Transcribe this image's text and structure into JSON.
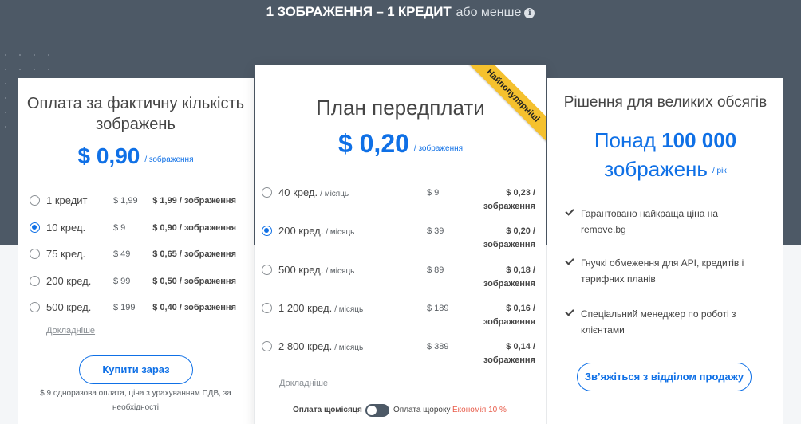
{
  "header": {
    "title": "1 ЗОБРАЖЕННЯ – 1 КРЕДИТ",
    "subtitle": "або менше",
    "info_icon": "i"
  },
  "pay_as_you_go": {
    "title": "Оплата за фактичну кількість зображень",
    "price": "$ 0,90",
    "price_unit": "/ зображення",
    "options": [
      {
        "label": "1 кредит",
        "price": "$ 1,99",
        "per_image": "$ 1,99 / зображення",
        "selected": false
      },
      {
        "label": "10 кред.",
        "price": "$ 9",
        "per_image": "$ 0,90 / зображення",
        "selected": true
      },
      {
        "label": "75 кред.",
        "price": "$ 49",
        "per_image": "$ 0,65 / зображення",
        "selected": false
      },
      {
        "label": "200 кред.",
        "price": "$ 99",
        "per_image": "$ 0,50 / зображення",
        "selected": false
      },
      {
        "label": "500 кред.",
        "price": "$ 199",
        "per_image": "$ 0,40 / зображення",
        "selected": false
      }
    ],
    "details_link": "Докладніше",
    "button": "Купити зараз",
    "footnote_line1": "$ 9 одноразова оплата, ціна з урахуванням ПДВ, за",
    "footnote_line2": "необхідності"
  },
  "subscription": {
    "title": "План передплати",
    "ribbon": "Найпопулярніші",
    "price": "$ 0,20",
    "price_unit": "/ зображення",
    "options": [
      {
        "label": "40 кред.",
        "per": "/ місяць",
        "price": "$ 9",
        "per_image_a": "$ 0,23 /",
        "per_image_b": "зображення",
        "selected": false
      },
      {
        "label": "200 кред.",
        "per": "/ місяць",
        "price": "$ 39",
        "per_image_a": "$ 0,20 /",
        "per_image_b": "зображення",
        "selected": true
      },
      {
        "label": "500 кред.",
        "per": "/ місяць",
        "price": "$ 89",
        "per_image_a": "$ 0,18 /",
        "per_image_b": "зображення",
        "selected": false
      },
      {
        "label": "1 200 кред.",
        "per": "/ місяць",
        "price": "$ 189",
        "per_image_a": "$ 0,16 /",
        "per_image_b": "зображення",
        "selected": false
      },
      {
        "label": "2 800 кред.",
        "per": "/ місяць",
        "price": "$ 389",
        "per_image_a": "$ 0,14 /",
        "per_image_b": "зображення",
        "selected": false
      }
    ],
    "details_link": "Докладніше",
    "billing_monthly": "Оплата щомісяця",
    "billing_yearly": "Оплата щороку",
    "billing_save": "Економія 10 %",
    "billing_is_yearly": false
  },
  "enterprise": {
    "title": "Рішення для великих обсягів",
    "volume_prefix": "Понад",
    "volume_number": "100 000",
    "volume_suffix": "зображень",
    "volume_unit": "/ рік",
    "features": [
      {
        "line1": "Гарантовано найкраща ціна на",
        "line2": "remove.bg"
      },
      {
        "line1": "Гнучкі обмеження для API, кредитів і",
        "line2": "тарифних планів"
      },
      {
        "line1": "Спеціальний менеджер по роботі з",
        "line2": "клієнтами"
      }
    ],
    "button": "Зв’яжіться з відділом продажу"
  },
  "colors": {
    "accent": "#0f70e6",
    "header_bg": "#4d5966",
    "ribbon": "#f5c12e",
    "save": "#e85c4a"
  }
}
